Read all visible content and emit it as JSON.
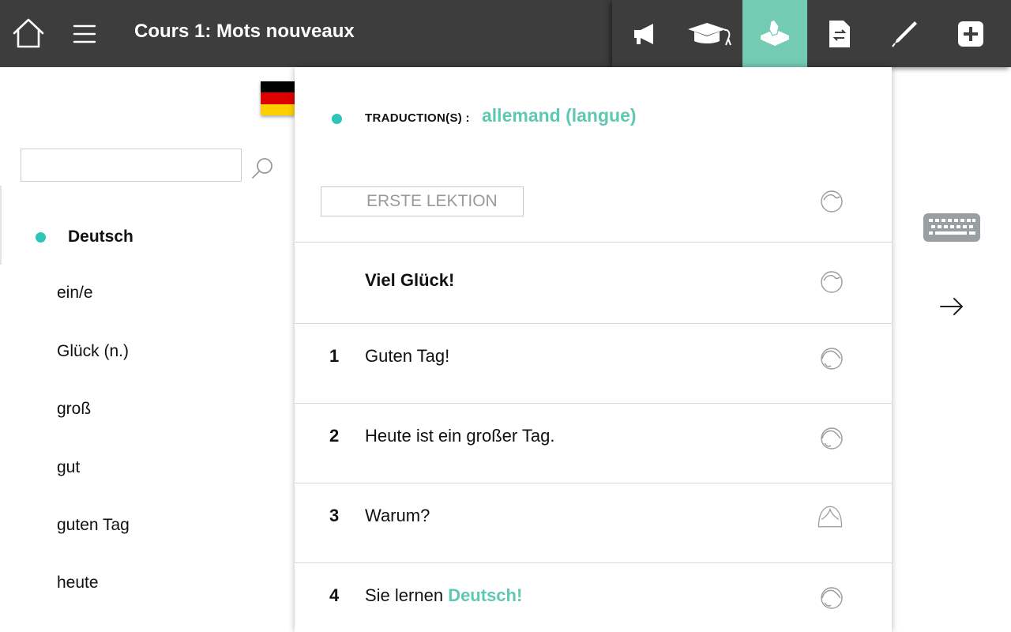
{
  "header": {
    "title": "Cours 1: Mots nouveaux",
    "home_icon": "home-icon",
    "menu_icon": "hamburger-menu-icon"
  },
  "toolbar": {
    "items": [
      {
        "icon": "megaphone-icon",
        "active": false
      },
      {
        "icon": "graduation-cap-icon",
        "active": false
      },
      {
        "icon": "hand-box-icon",
        "active": true
      },
      {
        "icon": "document-swap-icon",
        "active": false
      },
      {
        "icon": "pencil-icon",
        "active": false
      },
      {
        "icon": "plus-icon",
        "active": false
      }
    ],
    "active_color": "#74cbb4"
  },
  "flag": {
    "icon": "german-flag-icon",
    "colors": [
      "#000000",
      "#dd0000",
      "#ffce00"
    ]
  },
  "search": {
    "value": "",
    "placeholder": ""
  },
  "word_list": {
    "active_index": 0,
    "items": [
      "Deutsch",
      "ein/e",
      "Glück (n.)",
      "groß",
      "gut",
      "guten Tag",
      "heute"
    ]
  },
  "translation": {
    "label": "TRADUCTION(S) :",
    "value": "allemand (langue)"
  },
  "lesson": {
    "title": "ERSTE LEKTION",
    "heading": "Viel Glück!",
    "sentences": [
      {
        "num": "1",
        "text": "Guten Tag!",
        "highlight": ""
      },
      {
        "num": "2",
        "text": "Heute ist ein großer Tag.",
        "highlight": ""
      },
      {
        "num": "3",
        "text": "Warum?",
        "highlight": ""
      },
      {
        "num": "4",
        "text": "Sie lernen ",
        "highlight": "Deutsch!"
      }
    ]
  },
  "accent_color": "#5ec8b2",
  "dot_color": "#2ec4b6"
}
